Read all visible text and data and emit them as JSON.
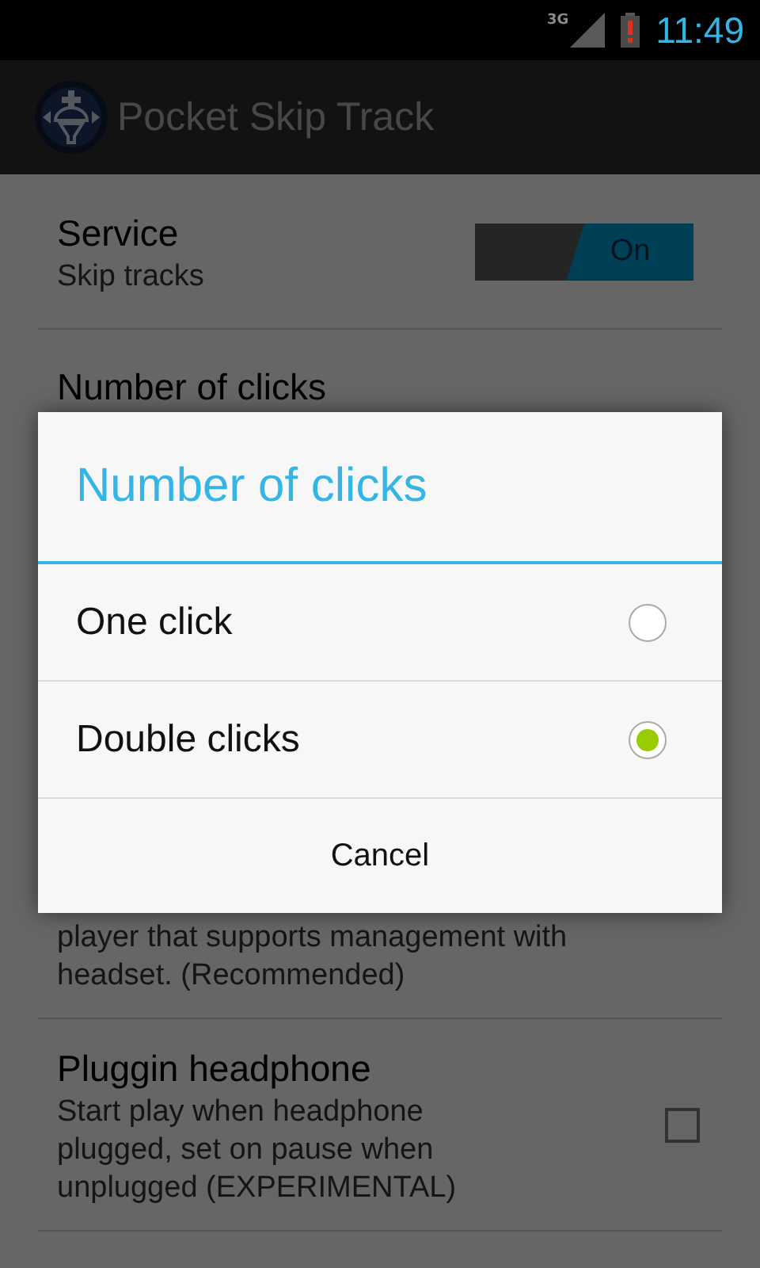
{
  "status_bar": {
    "network": "3G",
    "time": "11:49"
  },
  "app_bar": {
    "title": "Pocket Skip Track"
  },
  "preferences": [
    {
      "kind": "switch",
      "title": "Service",
      "summary": "Skip tracks",
      "on": true,
      "switch_label": "On"
    },
    {
      "kind": "list",
      "title": "Number of clicks"
    },
    {
      "kind": "list",
      "summary": "player that supports management with headset. (Recommended)"
    },
    {
      "kind": "checkbox",
      "title": "Pluggin headphone",
      "summary": "Start play when headphone plugged, set on pause when unplugged (EXPERIMENTAL)",
      "checked": false
    }
  ],
  "dialog": {
    "title": "Number of clicks",
    "options": [
      {
        "label": "One click",
        "selected": false
      },
      {
        "label": "Double clicks",
        "selected": true
      }
    ],
    "buttons": [
      "Cancel"
    ]
  }
}
